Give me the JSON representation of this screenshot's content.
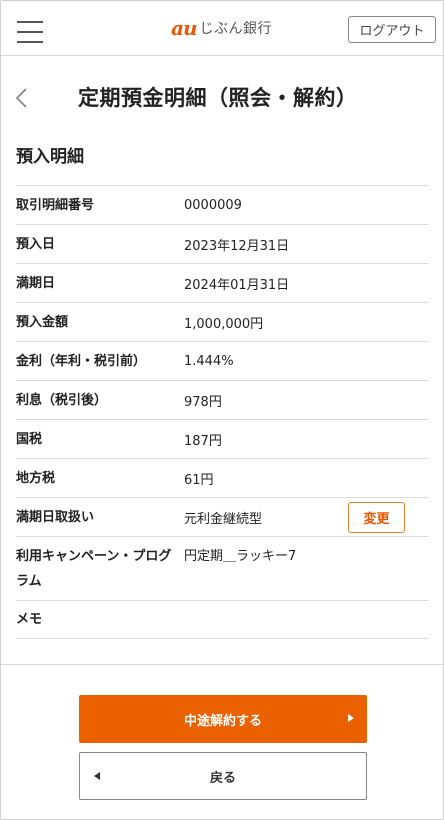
{
  "header": {
    "logo_mark": "au",
    "logo_text": "じぶん銀行",
    "logout_label": "ログアウト",
    "brand_color": "#eb5505"
  },
  "page": {
    "title": "定期預金明細（照会・解約）",
    "section_title": "預入明細"
  },
  "details": [
    {
      "label": "取引明細番号",
      "value": "0000009"
    },
    {
      "label": "預入日",
      "value": "2023年12月31日"
    },
    {
      "label": "満期日",
      "value": "2024年01月31日"
    },
    {
      "label": "預入金額",
      "value": "1,000,000円"
    },
    {
      "label": "金利（年利・税引前）",
      "value": "1.444%"
    },
    {
      "label": "利息（税引後）",
      "value": "978円"
    },
    {
      "label": "国税",
      "value": "187円"
    },
    {
      "label": "地方税",
      "value": "61円"
    },
    {
      "label": "満期日取扱い",
      "value": "元利金継続型",
      "action": "変更"
    },
    {
      "label": "利用キャンペーン・プログラム",
      "value": "円定期＿ラッキー7"
    },
    {
      "label": "メモ",
      "value": ""
    }
  ],
  "footer": {
    "primary_label": "中途解約する",
    "secondary_label": "戻る",
    "primary_color": "#eb6100"
  }
}
